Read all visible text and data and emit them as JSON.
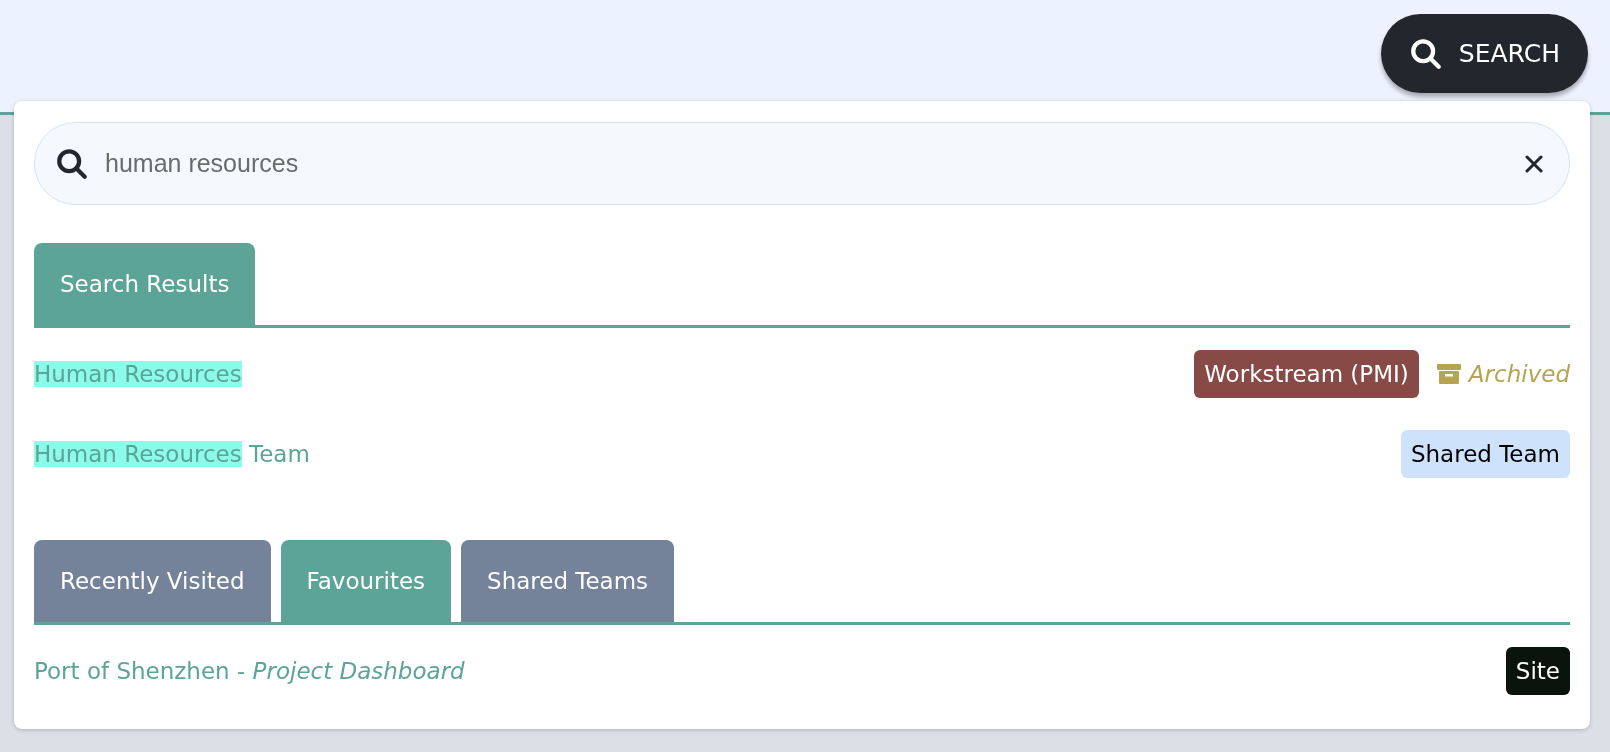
{
  "header": {
    "search_button": "SEARCH"
  },
  "search": {
    "value": "human resources"
  },
  "result_tabs": [
    {
      "label": "Search Results",
      "selected": true
    }
  ],
  "results": [
    {
      "match": "Human Resources",
      "badge": {
        "label": "Workstream (PMI)",
        "color": "#874a47"
      },
      "status": "Archived"
    },
    {
      "match": "Human Resources",
      "rest": " Team",
      "badge": {
        "label": "Shared Team",
        "color": "#cfe2fc"
      }
    }
  ],
  "list_tabs": [
    {
      "label": "Recently Visited",
      "selected": false
    },
    {
      "label": "Favourites",
      "selected": true
    },
    {
      "label": "Shared Teams",
      "selected": false
    }
  ],
  "list_items": [
    {
      "title": "Port of Shenzhen - *Project Dashboard*",
      "badge": {
        "label": "Site",
        "color": "#0a140d"
      }
    }
  ]
}
